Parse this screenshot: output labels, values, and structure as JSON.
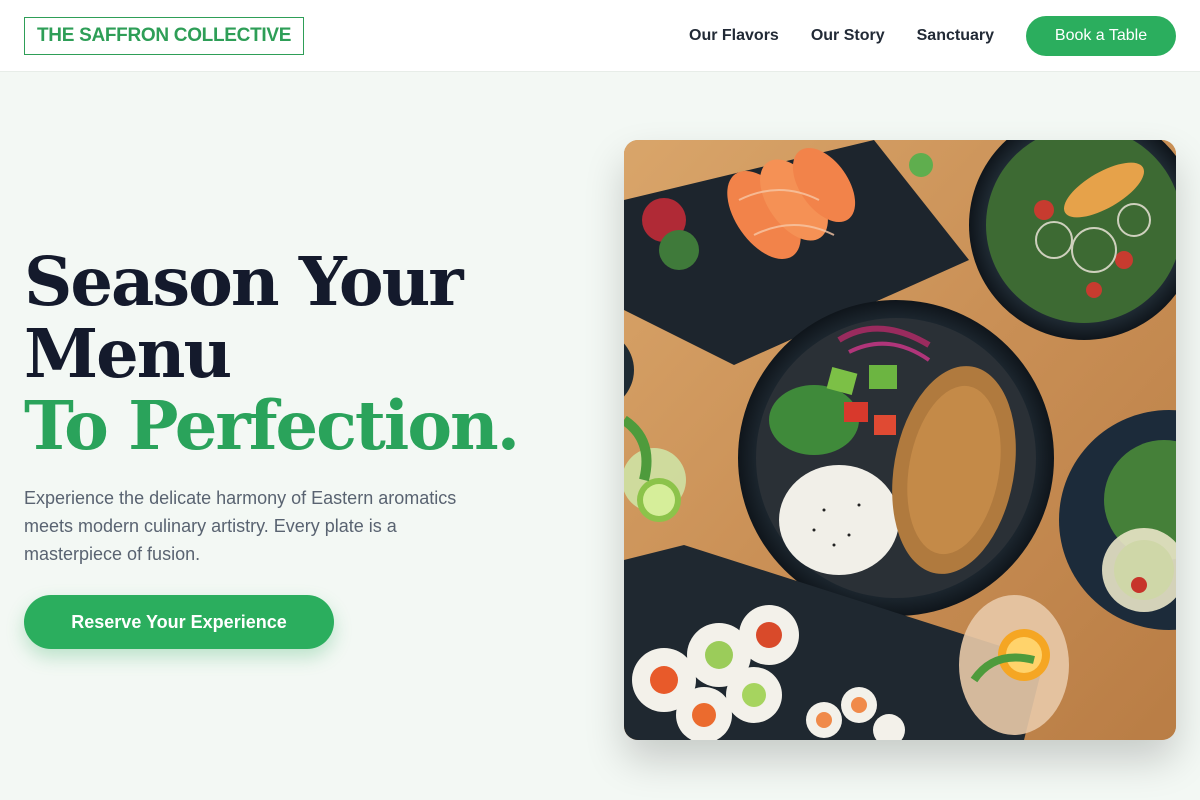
{
  "header": {
    "logo": "THE SAFFRON COLLECTIVE",
    "nav": [
      "Our Flavors",
      "Our Story",
      "Sanctuary"
    ],
    "cta": "Book a Table"
  },
  "hero": {
    "headline_line1": "Season Your",
    "headline_line2": "Menu",
    "headline_line3": "To Perfection.",
    "description": "Experience the delicate harmony of Eastern aromatics meets modern culinary artistry. Every plate is a masterpiece of fusion.",
    "button": "Reserve Your Experience",
    "image_alt": "Overhead view of Asian fusion dishes: poke bowl, sashimi, sushi rolls and salads on a wooden table"
  },
  "colors": {
    "accent": "#2bae5e",
    "headline_dark": "#141a2c",
    "background": "#f3f8f4"
  }
}
